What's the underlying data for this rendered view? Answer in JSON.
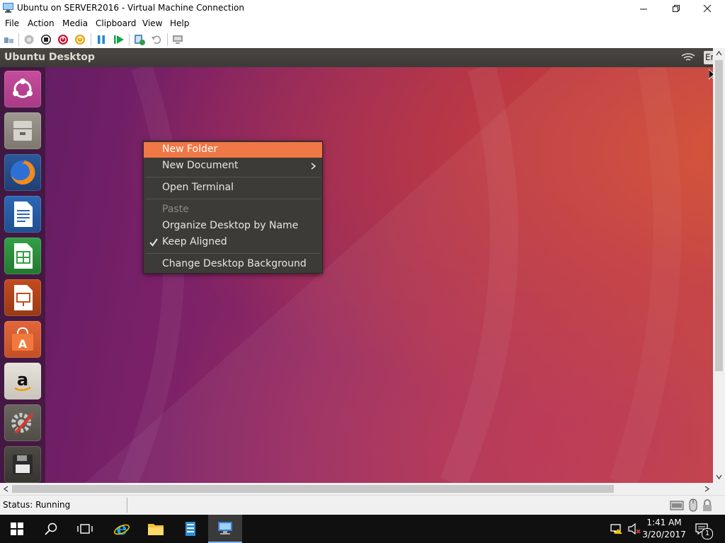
{
  "window": {
    "title": "Ubuntu on SERVER2016 - Virtual Machine Connection",
    "minimize_icon": "minimize-icon",
    "restore_icon": "restore-icon",
    "close_icon": "close-icon"
  },
  "menubar": {
    "items": [
      "File",
      "Action",
      "Media",
      "Clipboard",
      "View",
      "Help"
    ]
  },
  "toolbar": {
    "icons": [
      "ctrl-alt-del-icon",
      "start-icon",
      "turn-off-icon",
      "shut-down-icon",
      "save-icon",
      "pause-icon",
      "reset-icon",
      "checkpoint-icon",
      "revert-icon",
      "enhanced-session-icon"
    ]
  },
  "vm": {
    "panel_title": "Ubuntu Desktop",
    "panel_indicator": "En",
    "launcher": [
      "ubuntu-dash-icon",
      "files-icon",
      "firefox-icon",
      "libreoffice-writer-icon",
      "libreoffice-calc-icon",
      "libreoffice-impress-icon",
      "ubuntu-software-icon",
      "amazon-icon",
      "system-settings-icon",
      "save-disk-icon"
    ],
    "context_menu": {
      "items": [
        {
          "label": "New Folder",
          "state": "highlighted"
        },
        {
          "label": "New Document",
          "state": "normal",
          "submenu": true
        },
        {
          "label": "Open Terminal",
          "state": "normal"
        },
        {
          "label": "Paste",
          "state": "disabled"
        },
        {
          "label": "Organize Desktop by Name",
          "state": "normal"
        },
        {
          "label": "Keep Aligned",
          "state": "checked"
        },
        {
          "label": "Change Desktop Background",
          "state": "normal"
        }
      ]
    }
  },
  "statusbar": {
    "status": "Status: Running"
  },
  "taskbar": {
    "time": "1:41 AM",
    "date": "3/20/2017",
    "notification_count": "1"
  },
  "colors": {
    "menu_highlight": "#f07746",
    "menu_bg": "#3c3b37",
    "taskbar_bg": "#101010"
  }
}
